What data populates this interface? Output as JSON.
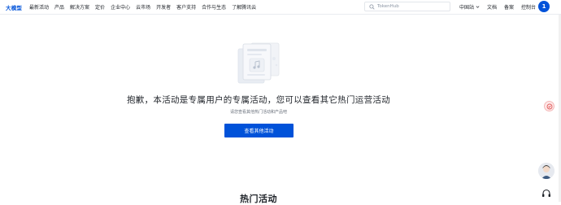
{
  "header": {
    "logo": "大模型",
    "nav": [
      {
        "label": "最新活动"
      },
      {
        "label": "产品"
      },
      {
        "label": "解决方案"
      },
      {
        "label": "定价"
      },
      {
        "label": "企业中心"
      },
      {
        "label": "云市场"
      },
      {
        "label": "开发者"
      },
      {
        "label": "客户支持"
      },
      {
        "label": "合作与生态"
      },
      {
        "label": "了解腾讯云"
      }
    ],
    "search": {
      "placeholder": "TokenHub"
    },
    "region": "中国站",
    "docs": "文档",
    "filing": "备案",
    "console": "控制台",
    "avatar_text": "1"
  },
  "main": {
    "headline": "抱歉，本活动是专属用户的专属活动，您可以查看其它热门运营活动",
    "subline": "请您查看其他热门活动和产品吧",
    "cta_label": "查看其他活动",
    "section_title": "热门活动"
  },
  "colors": {
    "primary": "#0052d9",
    "text": "#1f2329",
    "muted": "#6c737e"
  }
}
